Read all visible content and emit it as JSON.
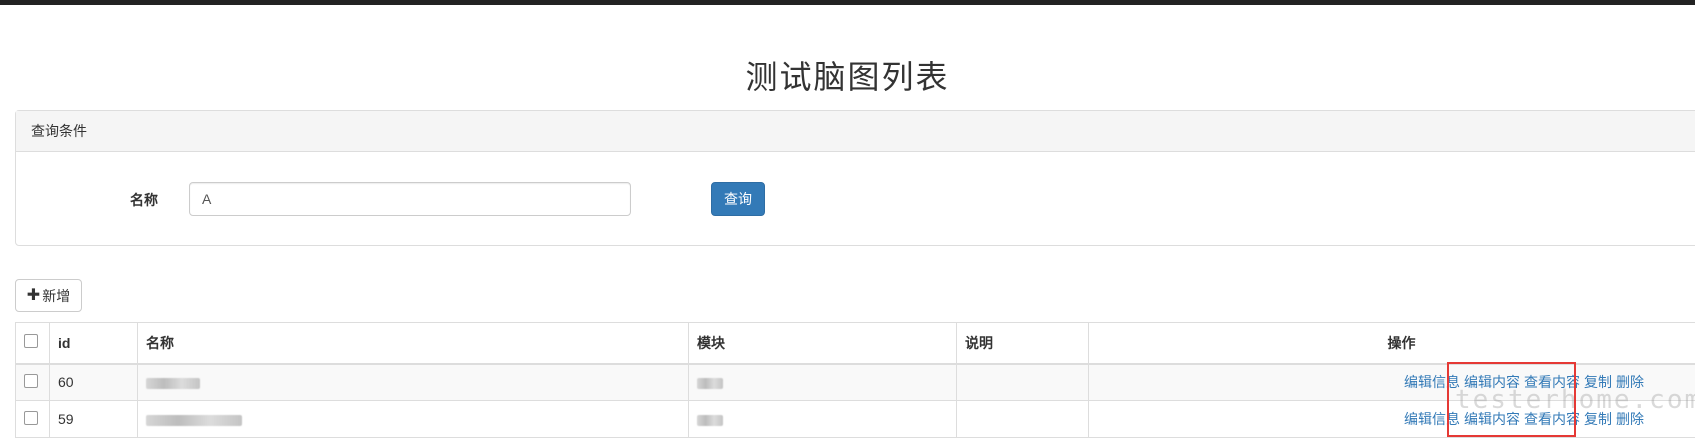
{
  "page": {
    "title": "测试脑图列表"
  },
  "query_panel": {
    "heading": "查询条件",
    "name_label": "名称",
    "name_value": "A",
    "query_button": "查询"
  },
  "toolbar": {
    "add_label": "新增",
    "add_icon": "plus-icon"
  },
  "table": {
    "headers": {
      "id": "id",
      "name": "名称",
      "module": "模块",
      "desc": "说明",
      "ops": "操作"
    },
    "rows": [
      {
        "id": "60",
        "desc": ""
      },
      {
        "id": "59",
        "desc": ""
      }
    ],
    "op_labels": [
      "编辑信息",
      "编辑内容",
      "查看内容",
      "复制",
      "删除"
    ]
  },
  "watermark": "testerhome.com",
  "colors": {
    "primary": "#337ab7",
    "highlight": "#e53935"
  }
}
